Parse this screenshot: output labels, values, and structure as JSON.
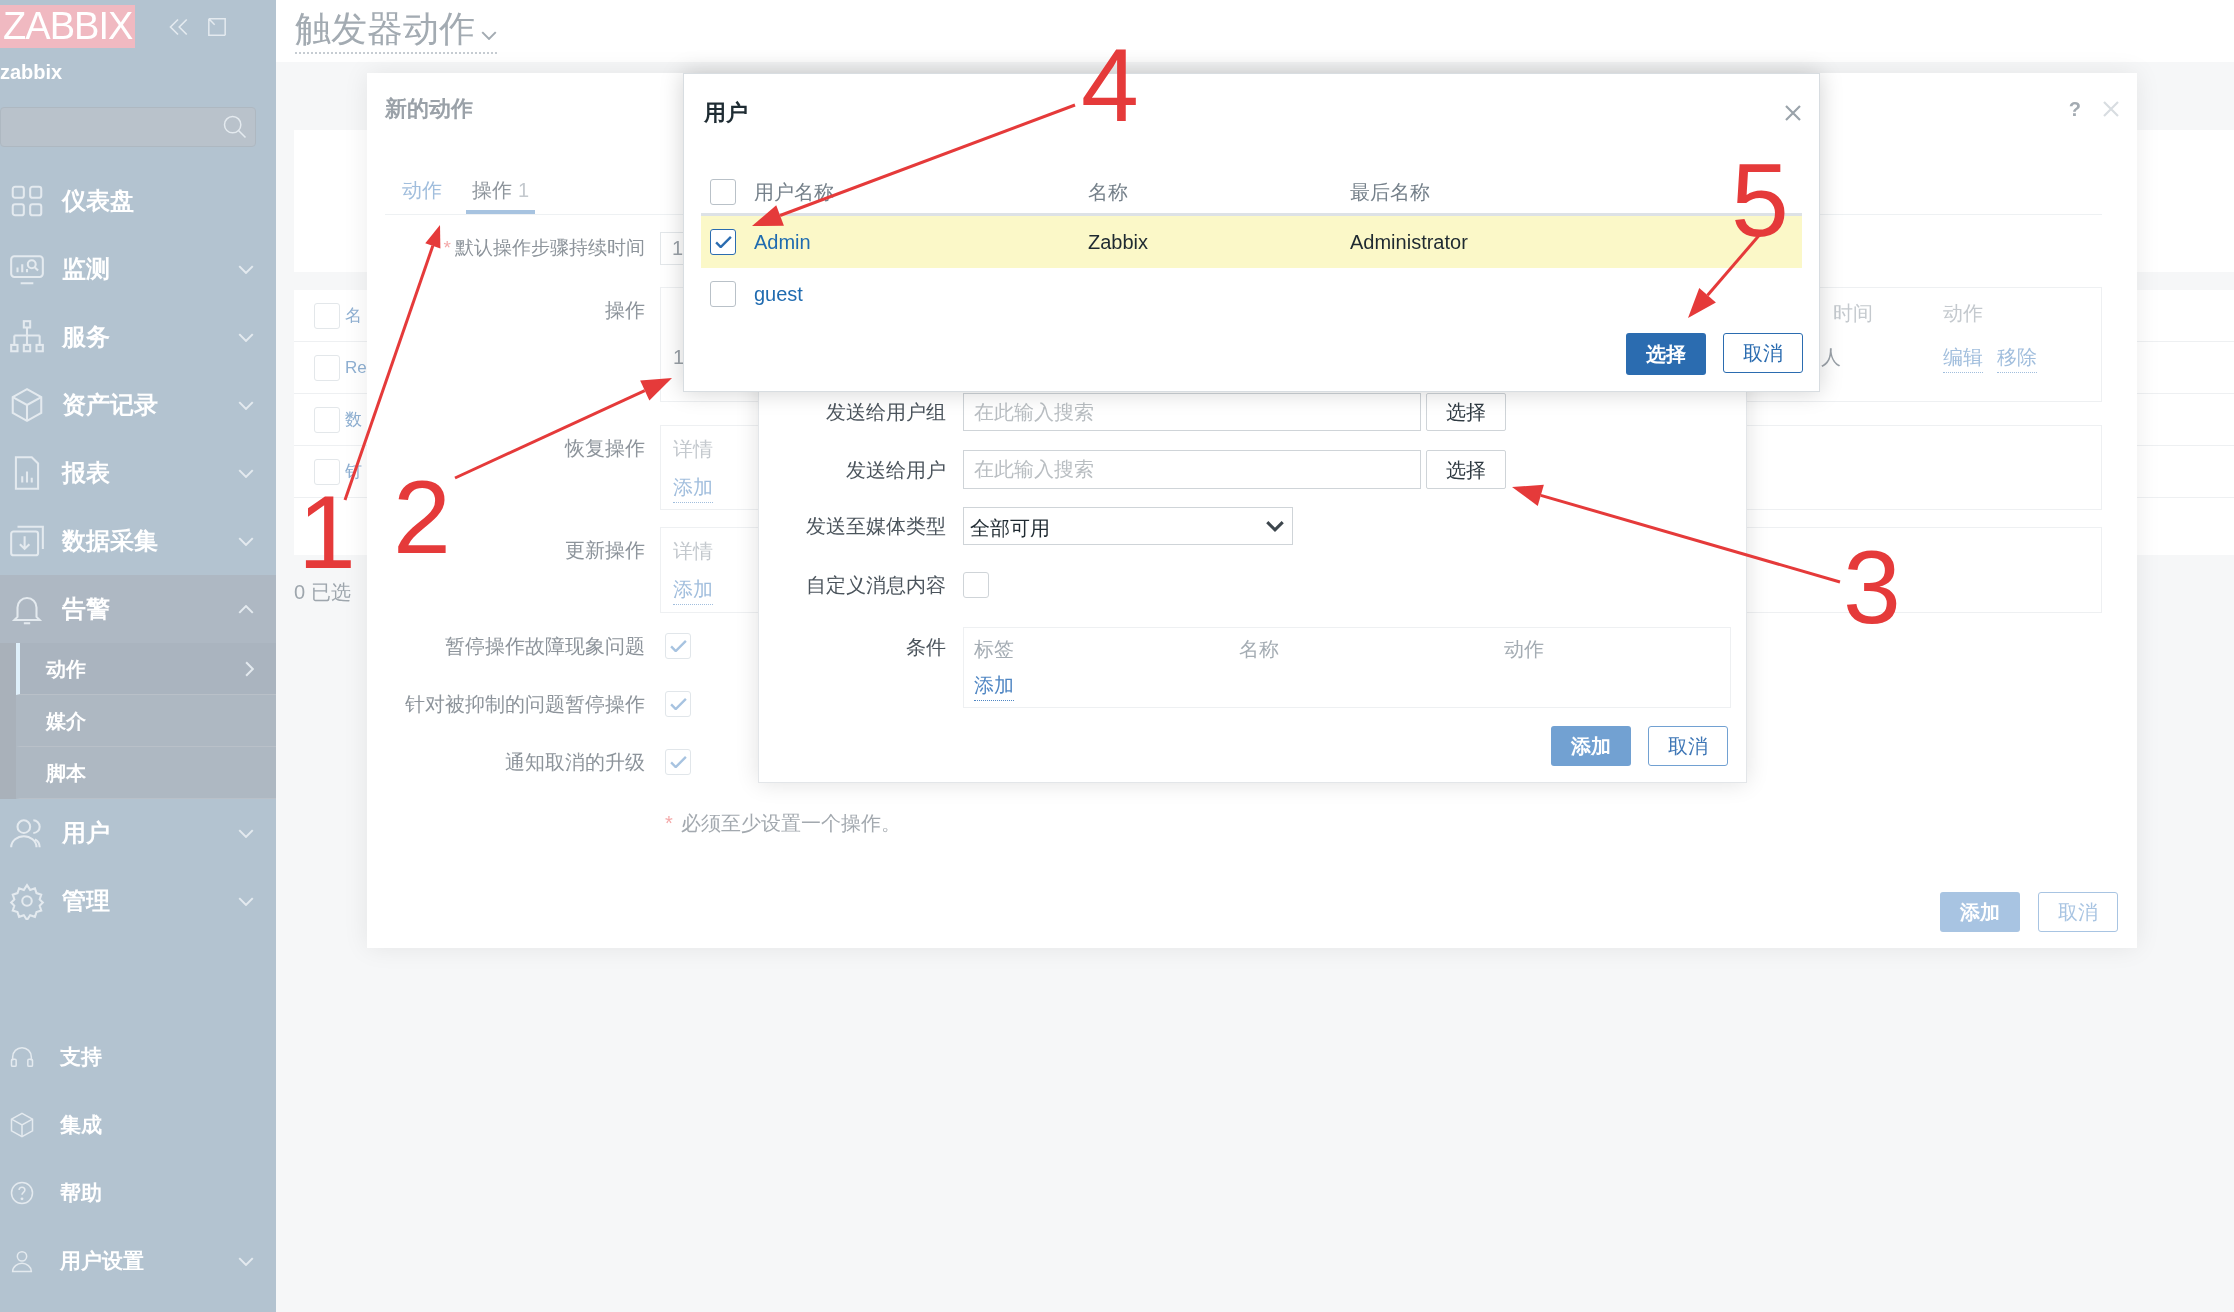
{
  "sidebar": {
    "logo": "ZABBIX",
    "server_name": "zabbix",
    "menu": [
      {
        "label": "仪表盘",
        "kind": "link"
      },
      {
        "label": "监测",
        "kind": "group",
        "expanded": false
      },
      {
        "label": "服务",
        "kind": "group",
        "expanded": false
      },
      {
        "label": "资产记录",
        "kind": "group",
        "expanded": false
      },
      {
        "label": "报表",
        "kind": "group",
        "expanded": false
      },
      {
        "label": "数据采集",
        "kind": "group",
        "expanded": false
      },
      {
        "label": "告警",
        "kind": "group",
        "expanded": true,
        "children": [
          {
            "label": "动作",
            "selected": true
          },
          {
            "label": "媒介",
            "selected": false
          },
          {
            "label": "脚本",
            "selected": false
          }
        ]
      },
      {
        "label": "用户",
        "kind": "group",
        "expanded": false
      },
      {
        "label": "管理",
        "kind": "group",
        "expanded": false
      }
    ],
    "footer_menu": [
      {
        "label": "支持",
        "kind": "link"
      },
      {
        "label": "集成",
        "kind": "link"
      },
      {
        "label": "帮助",
        "kind": "link"
      },
      {
        "label": "用户设置",
        "kind": "group",
        "expanded": false
      }
    ]
  },
  "page": {
    "title": "触发器动作",
    "table": {
      "header": {
        "label": "名",
        "checked": false
      },
      "rows": [
        {
          "label": "Re",
          "checked": false
        },
        {
          "label": "数",
          "checked": false
        },
        {
          "label": "钉",
          "checked": false
        }
      ]
    },
    "selected_count": "0 已选"
  },
  "action_dialog": {
    "title": "新的动作",
    "help": "?",
    "tabs": [
      {
        "label": "动作",
        "selected": false
      },
      {
        "label": "操作",
        "count": "1",
        "selected": true
      }
    ],
    "default_step_duration": {
      "mark": "*",
      "label": "默认操作步骤持续时间",
      "value": "1"
    },
    "operations": {
      "label": "操作",
      "step": "1",
      "column_duration": "时间",
      "column_action": "动作",
      "row_duration": "人",
      "actions": [
        "编辑",
        "移除"
      ]
    },
    "recovery_operations": {
      "label": "恢复操作",
      "details": "详情",
      "add": "添加"
    },
    "update_operations": {
      "label": "更新操作",
      "details": "详情",
      "add": "添加"
    },
    "options": [
      {
        "label": "暂停操作故障现象问题",
        "checked": true
      },
      {
        "label": "针对被抑制的问题暂停操作",
        "checked": true
      },
      {
        "label": "通知取消的升级",
        "checked": true
      }
    ],
    "note": {
      "mark": "*",
      "text": "必须至少设置一个操作。"
    },
    "buttons": [
      {
        "label": "添加",
        "kind": "primary"
      },
      {
        "label": "取消",
        "kind": "secondary"
      }
    ]
  },
  "operation_dialog": {
    "fields": [
      {
        "kind": "search",
        "label": "发送给用户组",
        "placeholder": "在此输入搜索",
        "button": "选择"
      },
      {
        "kind": "search",
        "label": "发送给用户",
        "placeholder": "在此输入搜索",
        "button": "选择"
      },
      {
        "kind": "select",
        "label": "发送至媒体类型",
        "value": "全部可用"
      },
      {
        "kind": "checkbox",
        "label": "自定义消息内容",
        "checked": false
      },
      {
        "kind": "conditions",
        "label": "条件",
        "columns": [
          "标签",
          "名称",
          "动作"
        ],
        "add": "添加"
      }
    ],
    "buttons": [
      {
        "label": "添加",
        "kind": "primary"
      },
      {
        "label": "取消",
        "kind": "secondary"
      }
    ]
  },
  "users_dialog": {
    "title": "用户",
    "all_checked": false,
    "columns": [
      "用户名称",
      "名称",
      "最后名称"
    ],
    "rows": [
      {
        "username": "Admin",
        "name": "Zabbix",
        "surname": "Administrator",
        "checked": true
      },
      {
        "username": "guest",
        "checked": false
      }
    ],
    "buttons": [
      {
        "label": "选择",
        "kind": "primary"
      },
      {
        "label": "取消",
        "kind": "secondary"
      }
    ]
  },
  "annotations": [
    {
      "label": "1"
    },
    {
      "label": "2"
    },
    {
      "label": "3"
    },
    {
      "label": "4"
    },
    {
      "label": "5"
    }
  ]
}
